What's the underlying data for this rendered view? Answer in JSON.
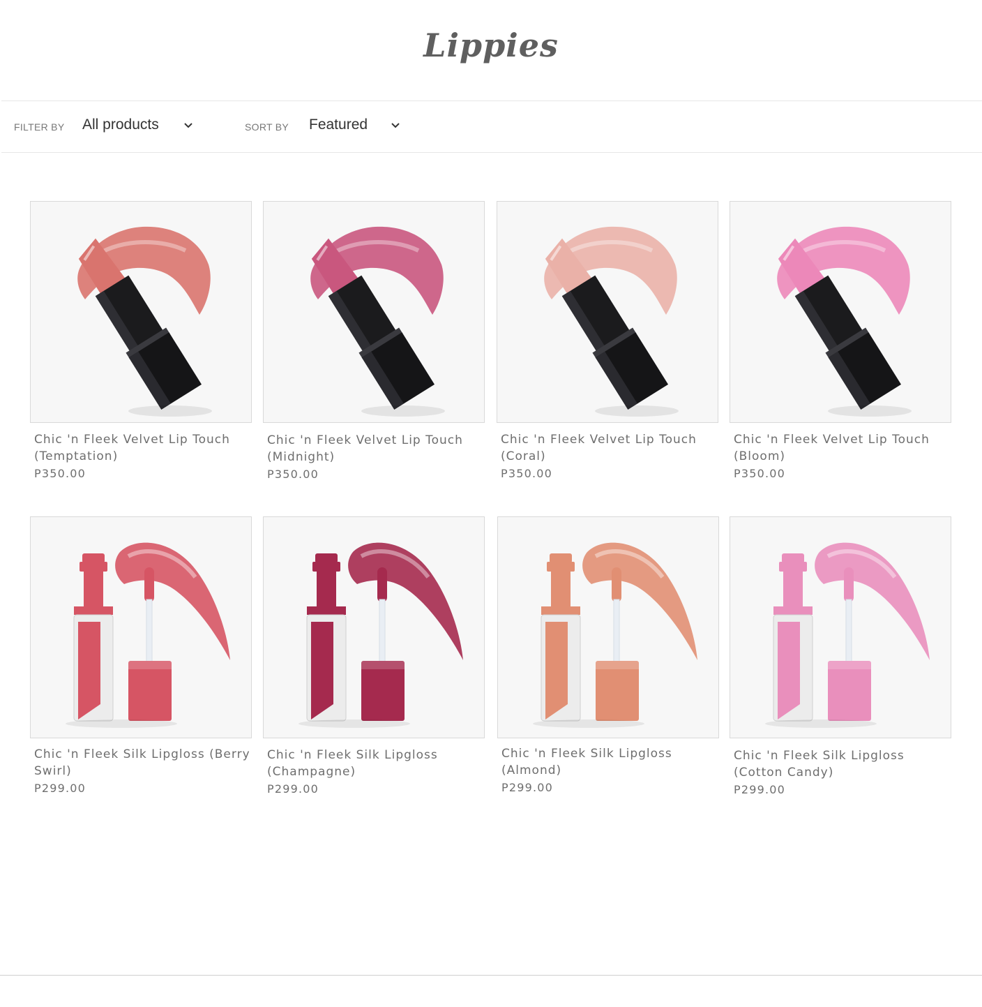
{
  "page": {
    "title": "Lippies"
  },
  "toolbar": {
    "filter_label": "FILTER BY",
    "filter_value": "All products",
    "sort_label": "SORT BY",
    "sort_value": "Featured"
  },
  "products": [
    {
      "name": "Chic 'n Fleek Velvet Lip Touch (Temptation)",
      "price": "P350.00",
      "kind": "lipstick",
      "shade_color": "#d9746e",
      "icon": "lipstick-icon"
    },
    {
      "name": "Chic 'n Fleek Velvet Lip Touch (Midnight)",
      "price": "P350.00",
      "kind": "lipstick",
      "shade_color": "#c9577e",
      "icon": "lipstick-icon"
    },
    {
      "name": "Chic 'n Fleek Velvet Lip Touch (Coral)",
      "price": "P350.00",
      "kind": "lipstick",
      "shade_color": "#eab1a8",
      "icon": "lipstick-icon"
    },
    {
      "name": "Chic 'n Fleek Velvet Lip Touch (Bloom)",
      "price": "P350.00",
      "kind": "lipstick",
      "shade_color": "#ec88b9",
      "icon": "lipstick-icon"
    },
    {
      "name": "Chic 'n Fleek Silk Lipgloss (Berry Swirl)",
      "price": "P299.00",
      "kind": "lipgloss",
      "shade_color": "#d65564",
      "icon": "lipgloss-icon"
    },
    {
      "name": "Chic 'n Fleek Silk Lipgloss (Champagne)",
      "price": "P299.00",
      "kind": "lipgloss",
      "shade_color": "#a52a4e",
      "icon": "lipgloss-icon"
    },
    {
      "name": "Chic 'n Fleek Silk Lipgloss (Almond)",
      "price": "P299.00",
      "kind": "lipgloss",
      "shade_color": "#e18f73",
      "icon": "lipgloss-icon"
    },
    {
      "name": "Chic 'n Fleek Silk Lipgloss (Cotton Candy)",
      "price": "P299.00",
      "kind": "lipgloss",
      "shade_color": "#e98fbc",
      "icon": "lipgloss-icon"
    }
  ]
}
